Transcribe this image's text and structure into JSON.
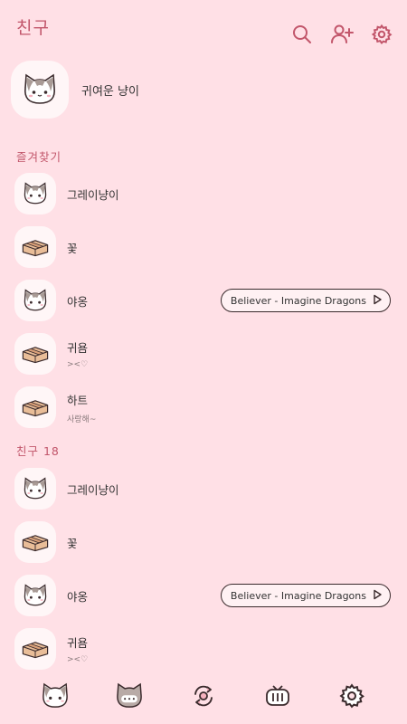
{
  "header": {
    "title": "친구",
    "icons": [
      "search-icon",
      "add-friend-icon",
      "settings-icon"
    ]
  },
  "profile": {
    "name": "귀여운 냥이",
    "avatar": "cat-avatar"
  },
  "favorites": {
    "label": "즐겨찾기",
    "items": [
      {
        "name": "그레이냥이",
        "status": "",
        "avatar": "cat",
        "music": ""
      },
      {
        "name": "꽃",
        "status": "",
        "avatar": "box",
        "music": ""
      },
      {
        "name": "야옹",
        "status": "",
        "avatar": "cat",
        "music": "Believer - Imagine Dragons"
      },
      {
        "name": "귀욤",
        "status": "><♡",
        "avatar": "box",
        "music": ""
      },
      {
        "name": "하트",
        "status": "사랑해~",
        "avatar": "box",
        "music": ""
      }
    ]
  },
  "friends": {
    "label": "친구 18",
    "items": [
      {
        "name": "그레이냥이",
        "status": "",
        "avatar": "cat",
        "music": ""
      },
      {
        "name": "꽃",
        "status": "",
        "avatar": "box",
        "music": ""
      },
      {
        "name": "야옹",
        "status": "",
        "avatar": "cat",
        "music": "Believer - Imagine Dragons"
      },
      {
        "name": "귀욤",
        "status": "><♡",
        "avatar": "box",
        "music": ""
      }
    ]
  },
  "tabbar": {
    "tabs": [
      "friends-tab-cat-icon",
      "chat-tab-icon",
      "openchat-tab-icon",
      "view-tab-tv-icon",
      "more-tab-gear-icon"
    ]
  },
  "colors": {
    "background": "#ffe0e6",
    "accent": "#c2566b"
  }
}
